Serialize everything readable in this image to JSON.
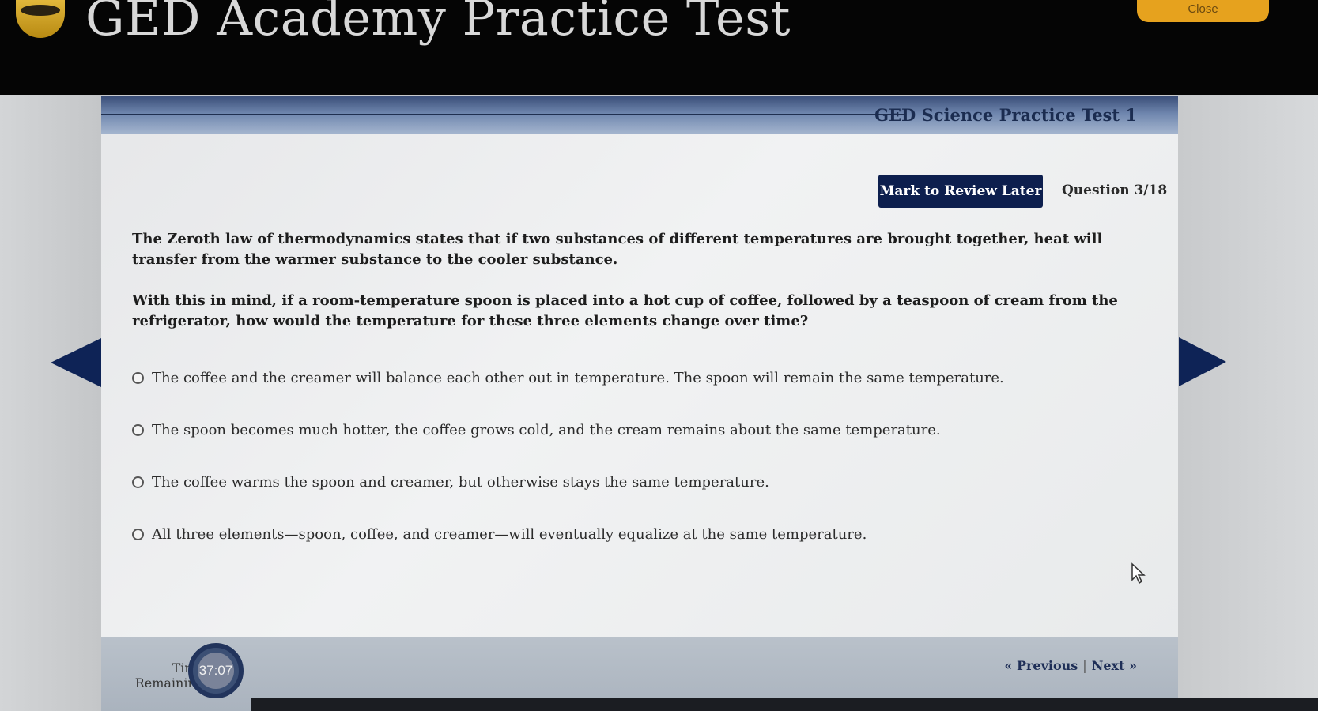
{
  "app": {
    "title": "GED Academy Practice Test",
    "close_label": "Close"
  },
  "panel": {
    "test_name": "GED Science Practice Test 1",
    "mark_review_label": "Mark to Review Later",
    "question_counter": "Question 3/18"
  },
  "question": {
    "paragraphs": [
      "The Zeroth law of thermodynamics states that if two substances of different temperatures are brought together, heat will transfer from the warmer substance to the cooler substance.",
      "With this in mind, if a room-temperature spoon is placed into a hot cup of coffee, followed by a teaspoon of cream from the refrigerator, how would the temperature for these three elements change over time?"
    ],
    "options": [
      "The coffee and the creamer will balance each other out in temperature. The spoon will remain the same temperature.",
      "The spoon becomes much hotter, the coffee grows cold, and the cream remains about the same temperature.",
      "The coffee warms the spoon and creamer, but otherwise stays the same temperature.",
      "All three elements—spoon, coffee, and creamer—will eventually equalize at the same temperature."
    ]
  },
  "footer": {
    "time_label_line1": "Time",
    "time_label_line2": "Remaining",
    "time_remaining": "37:07",
    "previous_label": "« Previous",
    "separator": "|",
    "next_label": "Next »"
  },
  "colors": {
    "navy": "#0e2356",
    "close_orange": "#e6a21e",
    "header_black": "#050505"
  },
  "icons": {
    "logo": "ged-logo-icon",
    "prev_arrow": "triangle-left-icon",
    "next_arrow": "triangle-right-icon",
    "cursor": "mouse-pointer-icon"
  }
}
